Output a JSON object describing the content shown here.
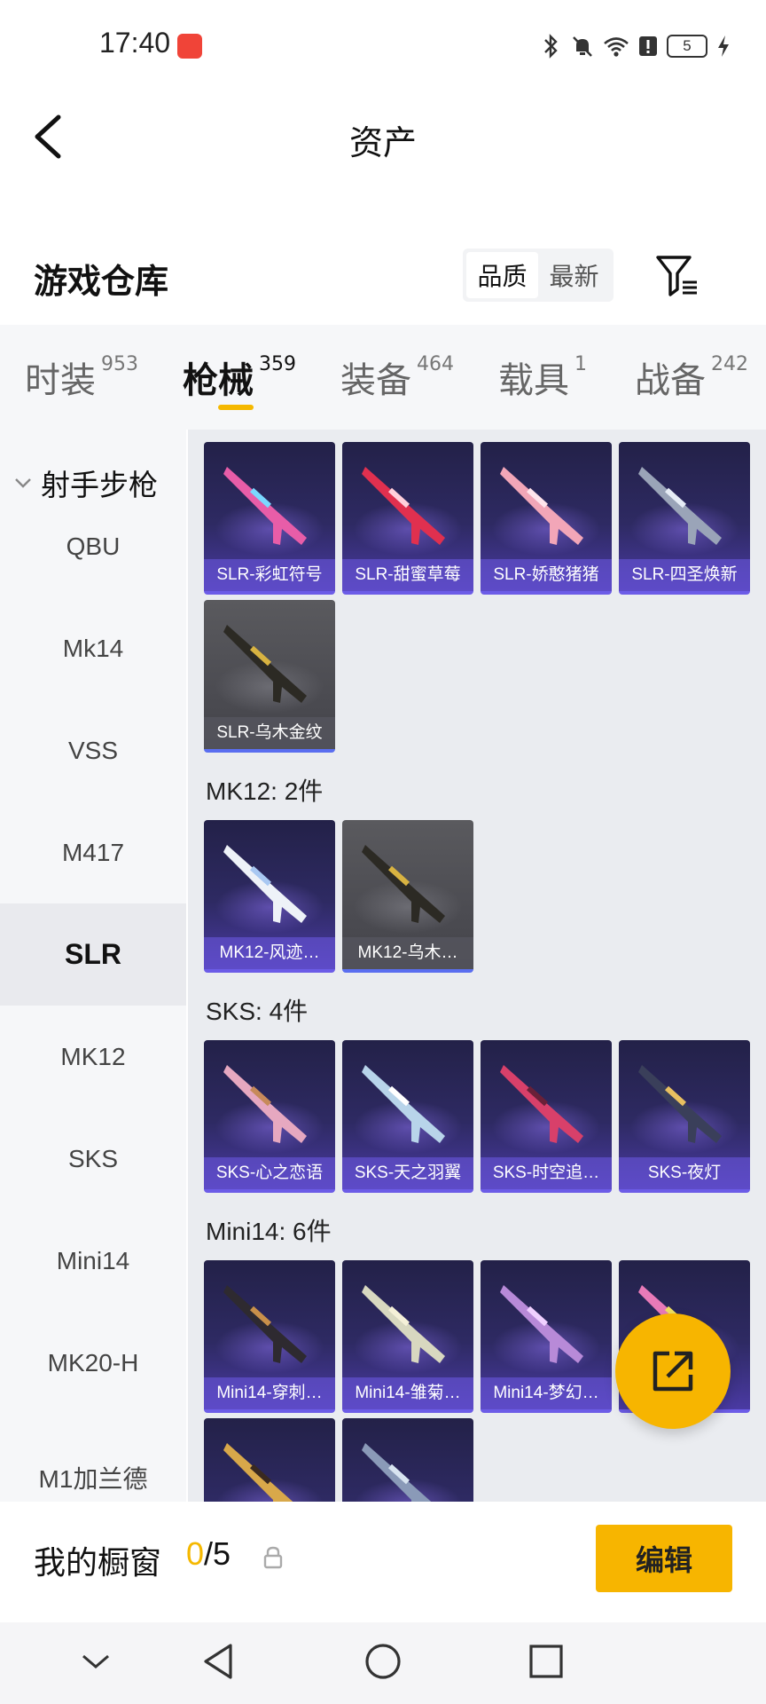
{
  "status_bar": {
    "time": "17:40",
    "battery": "5"
  },
  "header": {
    "title": "资产"
  },
  "warehouse": {
    "title": "游戏仓库",
    "sort_options": [
      "品质",
      "最新"
    ]
  },
  "category_tabs": [
    {
      "label": "时装",
      "count": "953"
    },
    {
      "label": "枪械",
      "count": "359"
    },
    {
      "label": "装备",
      "count": "464"
    },
    {
      "label": "载具",
      "count": "1"
    },
    {
      "label": "战备",
      "count": "242"
    }
  ],
  "sidebar": {
    "group": "射手步枪",
    "items": [
      "QBU",
      "Mk14",
      "VSS",
      "M417",
      "SLR",
      "MK12",
      "SKS",
      "Mini14",
      "MK20-H",
      "M1加兰德"
    ]
  },
  "sections": {
    "slr": {
      "items": [
        "SLR-彩虹符号",
        "SLR-甜蜜草莓",
        "SLR-娇憨猪猪",
        "SLR-四圣焕新",
        "SLR-乌木金纹"
      ]
    },
    "mk12": {
      "title": "MK12: 2件",
      "items": [
        "MK12-风迹…",
        "MK12-乌木…"
      ]
    },
    "sks": {
      "title": "SKS: 4件",
      "items": [
        "SKS-心之恋语",
        "SKS-天之羽翼",
        "SKS-时空追…",
        "SKS-夜灯"
      ]
    },
    "mini14": {
      "title": "Mini14: 6件",
      "items": [
        "Mini14-穿刺…",
        "Mini14-雏菊…",
        "Mini14-梦幻…"
      ]
    }
  },
  "showcase": {
    "label": "我的橱窗",
    "current": "0",
    "total": "/5",
    "edit_label": "编辑"
  },
  "colors": {
    "accent": "#f7b500",
    "card_purple": "#2e2a63",
    "card_gray": "#4c4c52"
  }
}
